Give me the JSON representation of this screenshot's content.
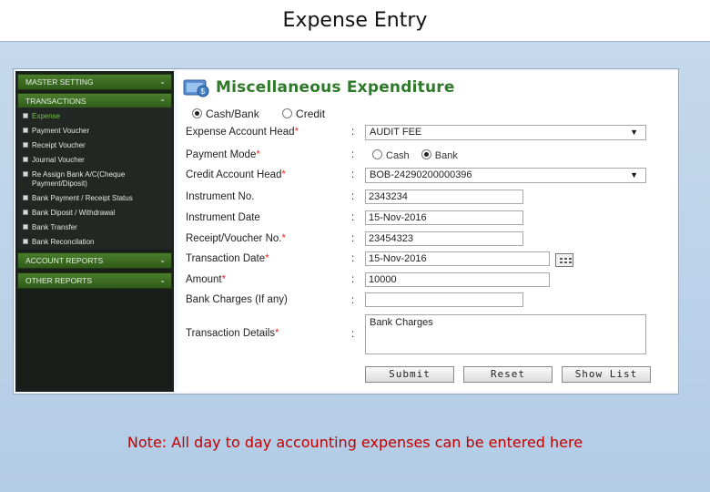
{
  "slide": {
    "title": "Expense Entry",
    "note": "Note: All day to day accounting expenses can be entered here"
  },
  "sidebar": {
    "sections": [
      {
        "label": "MASTER SETTING",
        "expanded": false
      },
      {
        "label": "TRANSACTIONS",
        "expanded": true
      },
      {
        "label": "ACCOUNT REPORTS",
        "expanded": false
      },
      {
        "label": "OTHER REPORTS",
        "expanded": false
      }
    ],
    "items": [
      {
        "label": "Expense",
        "active": true
      },
      {
        "label": "Payment Voucher"
      },
      {
        "label": "Receipt Voucher"
      },
      {
        "label": "Journal Voucher"
      },
      {
        "label": "Re Assign Bank A/C(Cheque Payment/Diposit)"
      },
      {
        "label": "Bank Payment / Receipt Status"
      },
      {
        "label": "Bank Diposit / Withdrawal"
      },
      {
        "label": "Bank Transfer"
      },
      {
        "label": "Bank Reconcilation"
      }
    ],
    "chevron_down": "⌄",
    "chevron_up": "⌃"
  },
  "form": {
    "title": "Miscellaneous Expenditure",
    "type_options": [
      {
        "label": "Cash/Bank",
        "selected": true
      },
      {
        "label": "Credit",
        "selected": false
      }
    ],
    "fields": {
      "expense_account_head": {
        "label": "Expense Account Head",
        "required": "*",
        "value": "AUDIT FEE"
      },
      "payment_mode": {
        "label": "Payment Mode",
        "required": "*",
        "options": [
          {
            "label": "Cash",
            "selected": false
          },
          {
            "label": "Bank",
            "selected": true
          }
        ]
      },
      "credit_account_head": {
        "label": "Credit Account Head",
        "required": "*",
        "value": "BOB-24290200000396"
      },
      "instrument_no": {
        "label": "Instrument No.",
        "value": "2343234"
      },
      "instrument_date": {
        "label": "Instrument Date",
        "value": "15-Nov-2016"
      },
      "receipt_voucher_no": {
        "label": "Receipt/Voucher No.",
        "required": "*",
        "value": "23454323"
      },
      "transaction_date": {
        "label": "Transaction Date",
        "required": "*",
        "value": "15-Nov-2016"
      },
      "amount": {
        "label": "Amount",
        "required": "*",
        "value": "10000"
      },
      "bank_charges": {
        "label": "Bank Charges (If any)",
        "value": ""
      },
      "transaction_details": {
        "label": "Transaction Details",
        "required": "*",
        "value": "Bank Charges"
      }
    },
    "colon": ":",
    "buttons": {
      "submit": "Submit",
      "reset": "Reset",
      "show_list": "Show List"
    },
    "dropdown_arrow": "▼"
  },
  "colors": {
    "accent_green": "#2f7a2a",
    "required_red": "#e2322b",
    "note_red": "#c00000",
    "sidebar_bg": "#1a1e1a",
    "sidebar_header": "#3f6f24"
  }
}
